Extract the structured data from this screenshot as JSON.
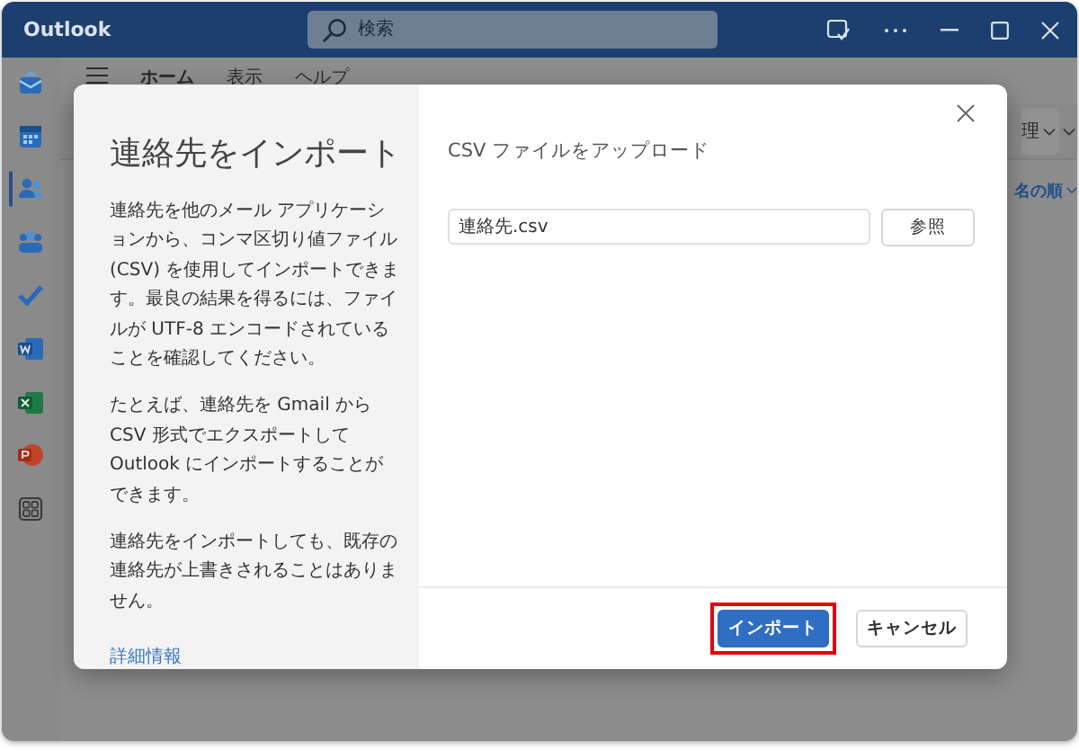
{
  "window": {
    "title": "Outlook"
  },
  "search": {
    "placeholder": "検索"
  },
  "rail": [
    {
      "kind": "mail",
      "selected": false
    },
    {
      "kind": "calendar",
      "selected": false
    },
    {
      "kind": "people",
      "selected": true
    },
    {
      "kind": "groups",
      "selected": false
    },
    {
      "kind": "todo",
      "selected": false
    },
    {
      "kind": "word",
      "selected": false
    },
    {
      "kind": "excel",
      "selected": false
    },
    {
      "kind": "powerpoint",
      "selected": false
    },
    {
      "kind": "apps",
      "selected": false
    }
  ],
  "ribbon_tabs": [
    {
      "label": "ホーム",
      "selected": true
    },
    {
      "label": "表示",
      "selected": false
    },
    {
      "label": "ヘルプ",
      "selected": false
    }
  ],
  "background": {
    "button_fragment": "理",
    "sort_fragment": "名の順"
  },
  "dialog": {
    "title": "連絡先をインポート",
    "paragraphs": [
      "連絡先を他のメール アプリケーションから、コンマ区切り値ファイル (CSV) を使用してインポートできます。最良の結果を得るには、ファイルが UTF-8 エンコードされていることを確認してください。",
      "たとえば、連絡先を Gmail から CSV 形式でエクスポートして Outlook にインポートすることができます。",
      "連絡先をインポートしても、既存の連絡先が上書きされることはありません。"
    ],
    "link": "詳細情報",
    "upload_label": "CSV ファイルをアップロード",
    "file_value": "連絡先.csv",
    "browse_button": "参照",
    "buttons": [
      {
        "label": "インポート",
        "kind": "primary",
        "highlighted": true
      },
      {
        "label": "キャンセル",
        "kind": "secondary",
        "highlighted": false
      }
    ]
  }
}
